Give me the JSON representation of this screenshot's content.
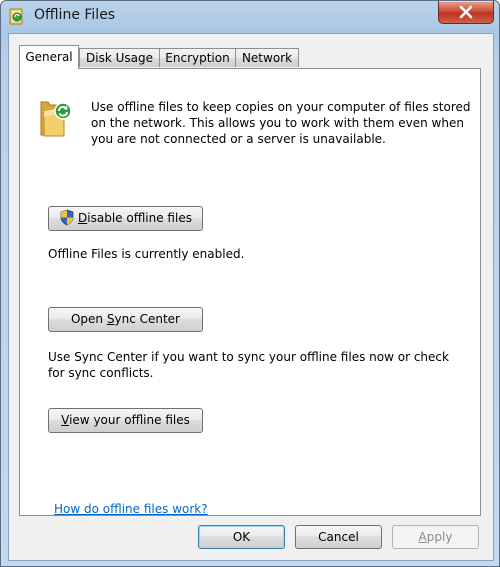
{
  "window": {
    "title": "Offline Files"
  },
  "tabs": [
    {
      "label": "General",
      "active": true
    },
    {
      "label": "Disk Usage",
      "active": false
    },
    {
      "label": "Encryption",
      "active": false
    },
    {
      "label": "Network",
      "active": false
    }
  ],
  "general": {
    "description": "Use offline files to keep copies on your computer of files stored on the network.  This allows you to work with them even when you are not connected or a server is unavailable.",
    "disable_button": {
      "prefix": "",
      "mnemonic": "D",
      "rest": "isable offline files"
    },
    "status_text": "Offline Files is currently enabled.",
    "sync_button": {
      "prefix": "Open ",
      "mnemonic": "S",
      "rest": "ync Center"
    },
    "sync_description": "Use Sync Center if you want to sync your offline files now or check for sync conflicts.",
    "view_button": {
      "prefix": "",
      "mnemonic": "V",
      "rest": "iew your offline files"
    },
    "help_link": "How do offline files work?"
  },
  "footer": {
    "ok_label": "OK",
    "cancel_label": "Cancel",
    "apply_prefix": "",
    "apply_mnemonic": "A",
    "apply_rest": "pply"
  },
  "colors": {
    "link": "#0066cc",
    "close_button": "#c94a35",
    "title_bar": "#b3cde8"
  },
  "icons": {
    "app": "offline-files-icon",
    "folder": "sync-folder-icon",
    "shield": "uac-shield-icon",
    "close": "close-icon"
  }
}
